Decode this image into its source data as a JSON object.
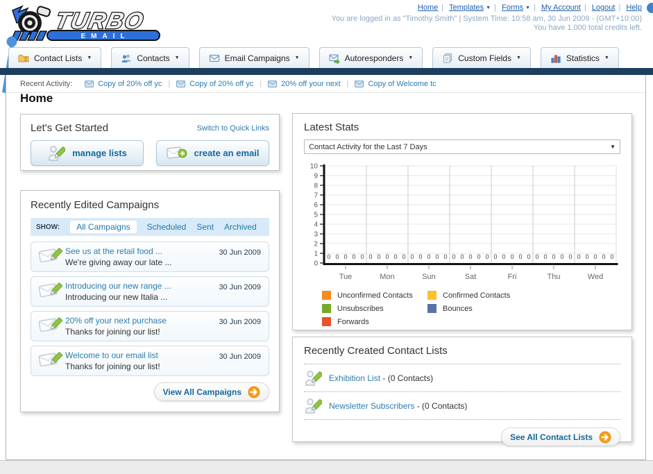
{
  "header": {
    "logo_title": "TURBO",
    "logo_subtitle": "EMAIL",
    "links": [
      {
        "label": "Home"
      },
      {
        "label": "Templates",
        "caret": true
      },
      {
        "label": "Forms",
        "caret": true
      },
      {
        "label": "My Account"
      },
      {
        "label": "Logout"
      },
      {
        "label": "Help"
      }
    ],
    "login_line": "You are logged in as \"Timothy Smith\" | System Time: 10:58 am, 30 Jun 2009 - (GMT+10:00)",
    "credits_line": "You have 1,000 total credits left."
  },
  "nav": {
    "items": [
      {
        "label": "Contact Lists"
      },
      {
        "label": "Contacts"
      },
      {
        "label": "Email Campaigns"
      },
      {
        "label": "Autoresponders"
      },
      {
        "label": "Custom Fields"
      },
      {
        "label": "Statistics"
      }
    ]
  },
  "recent_activity": {
    "label": "Recent Activity:",
    "items": [
      "Copy of 20% off yc",
      "Copy of 20% off yc",
      "20% off your next",
      "Copy of Welcome tc"
    ]
  },
  "page_title": "Home",
  "get_started": {
    "title": "Let's Get Started",
    "switch_link": "Switch to Quick Links",
    "manage_lists_label": "manage lists",
    "create_email_label": "create an email"
  },
  "campaigns": {
    "title": "Recently Edited Campaigns",
    "show_label": "SHOW:",
    "tabs": [
      "All Campaigns",
      "Scheduled",
      "Sent",
      "Archived"
    ],
    "active_tab": "All Campaigns",
    "items": [
      {
        "title": "See us at the retail food ...",
        "subtitle": "We're giving away our late ...",
        "date": "30 Jun 2009"
      },
      {
        "title": "Introducing our new range ...",
        "subtitle": "Introducing our new Italia ...",
        "date": "30 Jun 2009"
      },
      {
        "title": "20% off your next purchase",
        "subtitle": "Thanks for joining our list!",
        "date": "30 Jun 2009"
      },
      {
        "title": "Welcome to our email list",
        "subtitle": "Thanks for joining our list!",
        "date": "30 Jun 2009"
      }
    ],
    "view_all_label": "View All Campaigns"
  },
  "latest_stats": {
    "title": "Latest Stats",
    "dropdown_value": "Contact Activity for the Last 7 Days",
    "chart_data": {
      "type": "bar",
      "title": "Contact Activity for the Last 7 Days",
      "categories": [
        "Tue",
        "Mon",
        "Sun",
        "Sat",
        "Fri",
        "Thu",
        "Wed"
      ],
      "series": [
        {
          "name": "Unconfirmed Contacts",
          "color": "#F68B1F",
          "values": [
            0,
            0,
            0,
            0,
            0,
            0,
            0
          ]
        },
        {
          "name": "Confirmed Contacts",
          "color": "#FBC02D",
          "values": [
            0,
            0,
            0,
            0,
            0,
            0,
            0
          ]
        },
        {
          "name": "Unsubscribes",
          "color": "#76A829",
          "values": [
            0,
            0,
            0,
            0,
            0,
            0,
            0
          ]
        },
        {
          "name": "Bounces",
          "color": "#5872A7",
          "values": [
            0,
            0,
            0,
            0,
            0,
            0,
            0
          ]
        },
        {
          "name": "Forwards",
          "color": "#E9512E",
          "values": [
            0,
            0,
            0,
            0,
            0,
            0,
            0
          ]
        }
      ],
      "ylim": [
        0,
        10
      ],
      "ytick_step": 1,
      "grid": true,
      "value_labels": true,
      "legend_position": "bottom"
    }
  },
  "contact_lists": {
    "title": "Recently Created Contact Lists",
    "items": [
      {
        "name": "Exhibition List",
        "detail": "- (0 Contacts)"
      },
      {
        "name": "Newsletter Subscribers",
        "detail": "- (0 Contacts)"
      }
    ],
    "see_all_label": "See All Contact Lists"
  }
}
